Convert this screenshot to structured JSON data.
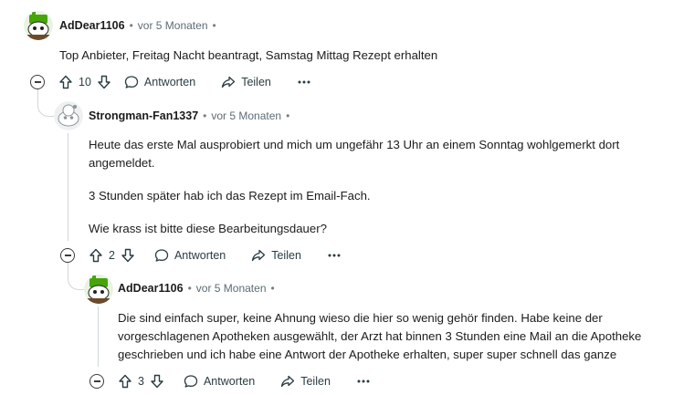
{
  "comments": [
    {
      "author": "AdDear1106",
      "time": "vor 5 Monaten",
      "avatar": "snoo-green-avatar",
      "paragraphs": [
        "Top Anbieter, Freitag Nacht beantragt, Samstag Mittag Rezept erhalten"
      ],
      "votes": "10",
      "reply_label": "Antworten",
      "share_label": "Teilen"
    },
    {
      "author": "Strongman-Fan1337",
      "time": "vor 5 Monaten",
      "avatar": "snoo-grey-avatar",
      "paragraphs": [
        "Heute das erste Mal ausprobiert und mich um ungefähr 13 Uhr an einem Sonntag wohlgemerkt dort angemeldet.",
        "3 Stunden später hab ich das Rezept im Email-Fach.",
        "Wie krass ist bitte diese Bearbeitungsdauer?"
      ],
      "votes": "2",
      "reply_label": "Antworten",
      "share_label": "Teilen"
    },
    {
      "author": "AdDear1106",
      "time": "vor 5 Monaten",
      "avatar": "snoo-green-avatar",
      "paragraphs": [
        "Die sind einfach super, keine Ahnung wieso die hier so wenig gehör finden. Habe keine der vorgeschlagenen Apotheken ausgewählt, der Arzt hat binnen 3 Stunden eine Mail an die Apotheke geschrieben und ich habe eine Antwort der Apotheke erhalten, super super schnell das ganze"
      ],
      "votes": "3",
      "reply_label": "Antworten",
      "share_label": "Teilen"
    }
  ],
  "separator": "•",
  "colors": {
    "text": "#1c1c1c",
    "meta": "#5c6c74",
    "thread_line": "#d0d7da",
    "avatar_green": "#46a508"
  }
}
